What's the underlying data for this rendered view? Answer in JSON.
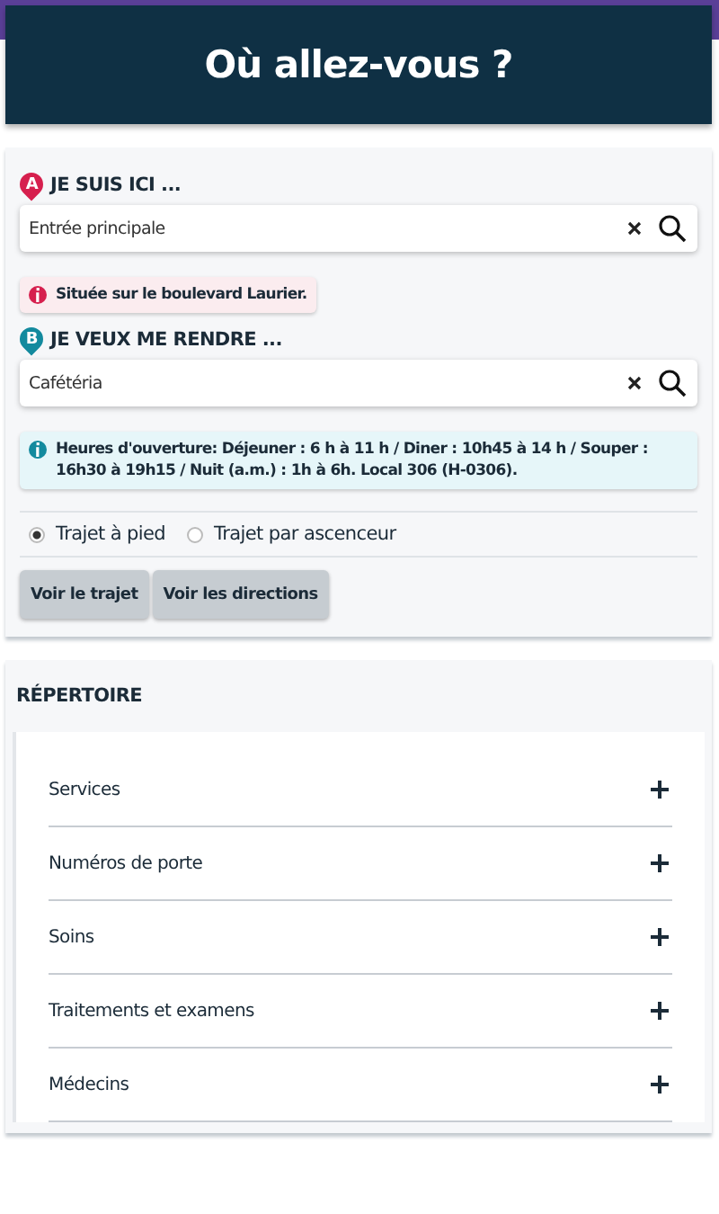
{
  "header": {
    "title": "Où allez-vous ?"
  },
  "points": [
    {
      "marker": "A",
      "color": "#d6204e",
      "label": "JE SUIS ICI ...",
      "value": "Entrée principale",
      "note": {
        "kind": "alert",
        "text": "Située sur le boulevard Laurier."
      }
    },
    {
      "marker": "B",
      "color": "#138a9e",
      "label": "JE VEUX ME RENDRE ...",
      "value": "Cafétéria",
      "note": {
        "kind": "info",
        "text": "Heures d'ouverture: Déjeuner : 6 h à 11 h / Diner : 10h45 à 14 h / Souper : 16h30 à 19h15 / Nuit (a.m.) : 1h à 6h. Local 306 (H-0306)."
      }
    }
  ],
  "route_options": [
    {
      "label": "Trajet à pied",
      "selected": true
    },
    {
      "label": "Trajet par ascenceur",
      "selected": false
    }
  ],
  "buttons": [
    "Voir le trajet",
    "Voir les directions"
  ],
  "directory": {
    "title": "RÉPERTOIRE",
    "items": [
      {
        "label": "Services",
        "expanded": false
      },
      {
        "label": "Numéros de porte",
        "expanded": false
      },
      {
        "label": "Soins",
        "expanded": false
      },
      {
        "label": "Traitements et examens",
        "expanded": false
      },
      {
        "label": "Médecins",
        "expanded": false
      }
    ]
  }
}
